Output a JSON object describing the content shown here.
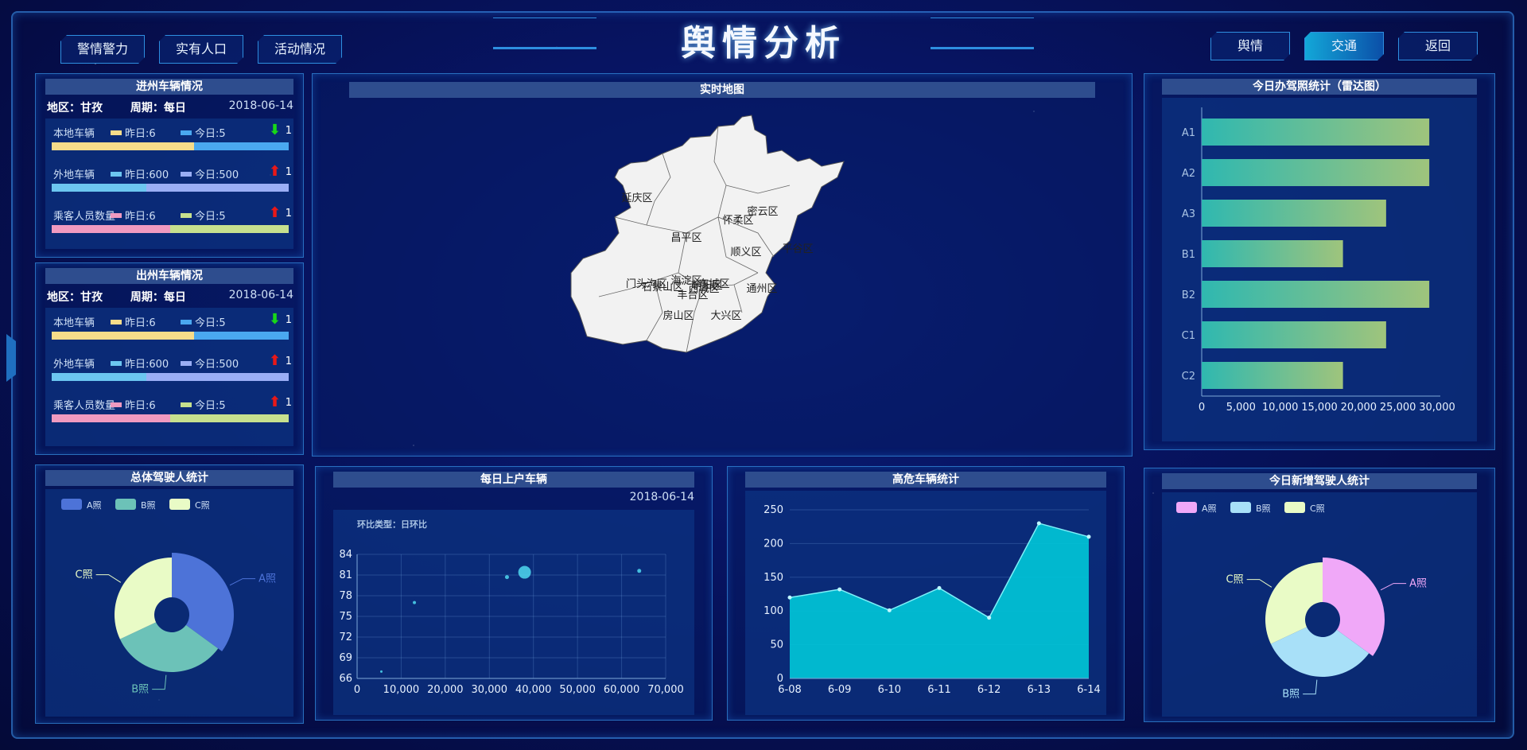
{
  "title": "舆情分析",
  "nav_left": [
    "警情警力",
    "实有人口",
    "活动情况"
  ],
  "nav_right": [
    "舆情",
    "交通",
    "返回"
  ],
  "nav_right_active": "交通",
  "in_vehicles": {
    "title": "进州车辆情况",
    "region": "地区：甘孜",
    "period": "周期：每日",
    "date": "2018-06-14",
    "metrics": [
      {
        "label": "本地车辆",
        "yesterday": "昨日:6",
        "today": "今日:5",
        "trend": "down",
        "delta": "1",
        "yesterday_color": "#f7dc8a",
        "today_color": "#4aa8f0",
        "yesterday_frac": 0.6
      },
      {
        "label": "外地车辆",
        "yesterday": "昨日:600",
        "today": "今日:500",
        "trend": "up",
        "delta": "1",
        "yesterday_color": "#6cc6f0",
        "today_color": "#9aaef5",
        "yesterday_frac": 0.4
      },
      {
        "label": "乘客人员数量",
        "yesterday": "昨日:6",
        "today": "今日:5",
        "trend": "up",
        "delta": "1",
        "yesterday_color": "#f09ac0",
        "today_color": "#c6e08e",
        "yesterday_frac": 0.5
      }
    ]
  },
  "out_vehicles": {
    "title": "出州车辆情况",
    "region": "地区：甘孜",
    "period": "周期：每日",
    "date": "2018-06-14",
    "metrics": [
      {
        "label": "本地车辆",
        "yesterday": "昨日:6",
        "today": "今日:5",
        "trend": "down",
        "delta": "1",
        "yesterday_color": "#f7dc8a",
        "today_color": "#4aa8f0",
        "yesterday_frac": 0.6
      },
      {
        "label": "外地车辆",
        "yesterday": "昨日:600",
        "today": "今日:500",
        "trend": "up",
        "delta": "1",
        "yesterday_color": "#6cc6f0",
        "today_color": "#9aaef5",
        "yesterday_frac": 0.4
      },
      {
        "label": "乘客人员数量",
        "yesterday": "昨日:6",
        "today": "今日:5",
        "trend": "up",
        "delta": "1",
        "yesterday_color": "#f09ac0",
        "today_color": "#c6e08e",
        "yesterday_frac": 0.5
      }
    ]
  },
  "map": {
    "title": "实时地图",
    "districts": [
      "延庆区",
      "怀柔区",
      "密云区",
      "昌平区",
      "顺义区",
      "平谷区",
      "门头沟区",
      "海淀区",
      "石景山区",
      "朝阳区",
      "通州区",
      "丰台区",
      "东城区",
      "西城区",
      "房山区",
      "大兴区"
    ]
  },
  "license_stats": {
    "title": "今日办驾照统计（雷达图）",
    "chart_data": {
      "type": "bar",
      "orientation": "horizontal",
      "categories": [
        "A1",
        "A2",
        "A3",
        "B1",
        "B2",
        "C1",
        "C2"
      ],
      "values": [
        29000,
        29000,
        23500,
        18000,
        29000,
        23500,
        18000
      ],
      "xlim": [
        0,
        30000
      ],
      "xticks": [
        "0",
        "5,000",
        "10,000",
        "15,000",
        "20,000",
        "25,000",
        "30,000"
      ]
    }
  },
  "total_drivers": {
    "title": "总体驾驶人统计",
    "chart_data": {
      "type": "pie",
      "legend": [
        "A照",
        "B照",
        "C照"
      ],
      "values": [
        35,
        33,
        32
      ],
      "colors": [
        "#4d73d8",
        "#6cc2b8",
        "#e9fbc6"
      ],
      "labels": [
        "A照",
        "B照",
        "C照"
      ]
    }
  },
  "daily_registered": {
    "title": "每日上户车辆",
    "date": "2018-06-14",
    "subtitle": "环比类型：日环比",
    "chart_data": {
      "type": "scatter",
      "x": [
        5500,
        13000,
        34000,
        38000,
        64000
      ],
      "y": [
        67,
        77,
        80.7,
        81.4,
        81.6
      ],
      "xlim": [
        0,
        70000
      ],
      "ylim": [
        66,
        84
      ],
      "xticks": [
        "0",
        "10,000",
        "20,000",
        "30,000",
        "40,000",
        "50,000",
        "60,000",
        "70,000"
      ],
      "yticks": [
        "66",
        "69",
        "72",
        "75",
        "78",
        "81",
        "84"
      ]
    }
  },
  "high_risk": {
    "title": "高危车辆统计",
    "chart_data": {
      "type": "area",
      "categories": [
        "6-08",
        "6-09",
        "6-10",
        "6-11",
        "6-12",
        "6-13",
        "6-14"
      ],
      "values": [
        120,
        132,
        101,
        134,
        90,
        230,
        210
      ],
      "ylim": [
        0,
        250
      ],
      "yticks": [
        "0",
        "50",
        "100",
        "150",
        "200",
        "250"
      ],
      "color": "#00c8d8"
    }
  },
  "new_drivers": {
    "title": "今日新增驾驶人统计",
    "chart_data": {
      "type": "pie",
      "legend": [
        "A照",
        "B照",
        "C照"
      ],
      "values": [
        35,
        33,
        32
      ],
      "colors": [
        "#f0a8f8",
        "#a8e0f8",
        "#e9fbc6"
      ],
      "labels": [
        "A照",
        "B照",
        "C照"
      ]
    }
  }
}
